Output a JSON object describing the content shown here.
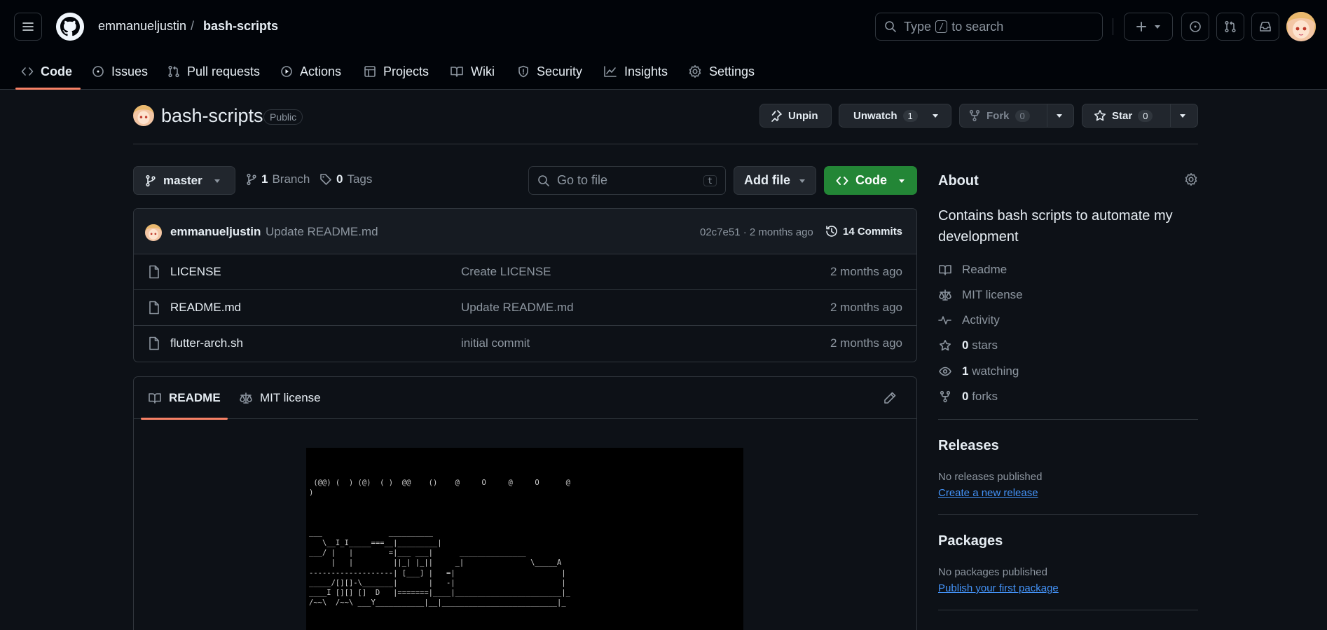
{
  "header": {
    "owner": "emmanueljustin",
    "separator": "/",
    "repo": "bash-scripts",
    "search": {
      "prefix": "Type",
      "key": "/",
      "suffix": "to search"
    }
  },
  "nav": {
    "tabs": [
      {
        "label": "Code",
        "icon": "code-icon",
        "active": true
      },
      {
        "label": "Issues",
        "icon": "issue-icon"
      },
      {
        "label": "Pull requests",
        "icon": "pull-request-icon"
      },
      {
        "label": "Actions",
        "icon": "play-icon"
      },
      {
        "label": "Projects",
        "icon": "table-icon"
      },
      {
        "label": "Wiki",
        "icon": "book-icon"
      },
      {
        "label": "Security",
        "icon": "shield-icon"
      },
      {
        "label": "Insights",
        "icon": "graph-icon"
      },
      {
        "label": "Settings",
        "icon": "gear-icon"
      }
    ]
  },
  "repo_head": {
    "name": "bash-scripts",
    "visibility": "Public",
    "unpin_label": "Unpin",
    "unwatch_label": "Unwatch",
    "watch_count": "1",
    "fork_label": "Fork",
    "fork_count": "0",
    "star_label": "Star",
    "star_count": "0"
  },
  "toolbar": {
    "branch": "master",
    "branches_count": "1",
    "branches_label": "Branch",
    "tags_count": "0",
    "tags_label": "Tags",
    "goto_placeholder": "Go to file",
    "goto_key": "t",
    "add_file_label": "Add file",
    "code_label": "Code"
  },
  "latest_commit": {
    "author": "emmanueljustin",
    "message": "Update README.md",
    "meta": "02c7e51 · 2 months ago",
    "commits_label": "14 Commits"
  },
  "files": [
    {
      "name": "LICENSE",
      "message": "Create LICENSE",
      "date": "2 months ago"
    },
    {
      "name": "README.md",
      "message": "Update README.md",
      "date": "2 months ago"
    },
    {
      "name": "flutter-arch.sh",
      "message": "initial commit",
      "date": "2 months ago"
    }
  ],
  "readme": {
    "tab_readme": "README",
    "tab_license": "MIT license",
    "ascii_art": "\n\n\n (@@) (  ) (@)  ( )  @@    ()    @     O     @     O      @\n)\n\n\n\n___               __________\n   \\__I_I_____===__|_________|\n___/ |   |        =|___ ___|      _______________\n     |   |         ||_| |_||     _|               \\_____A\n-------------------| [___] |   =|                        |\n_____/[][]-\\_______|       |   -|                        |\n____I [][] []  D   |=======|____|________________________|_\n/~~\\  /~~\\ ___Y___________|__|__________________________|_"
  },
  "about": {
    "heading": "About",
    "description": "Contains bash scripts to automate my development",
    "readme": "Readme",
    "license": "MIT license",
    "activity": "Activity",
    "stars_count": "0",
    "stars_label": "stars",
    "watching_count": "1",
    "watching_label": "watching",
    "forks_count": "0",
    "forks_label": "forks"
  },
  "releases": {
    "heading": "Releases",
    "empty": "No releases published",
    "link": "Create a new release"
  },
  "packages": {
    "heading": "Packages",
    "empty": "No packages published",
    "link": "Publish your first package"
  },
  "colors": {
    "background": "#0d1117",
    "header_background": "#010409",
    "accent_underline": "#f78166",
    "code_button": "#238636",
    "link": "#4493f8"
  }
}
